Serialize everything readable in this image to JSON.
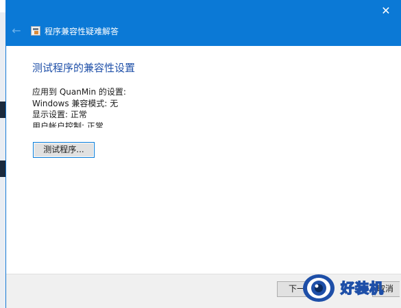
{
  "window": {
    "title": "程序兼容性疑难解答",
    "close_glyph": "✕",
    "back_glyph": "←"
  },
  "main": {
    "heading": "测试程序的兼容性设置",
    "settings": [
      "应用到  QuanMin 的设置:",
      "Windows 兼容模式: 无",
      "显示设置:  正常",
      "用户帐户控制:  正常"
    ],
    "test_button_label": "测试程序..."
  },
  "footer": {
    "next_label": "下一步",
    "cancel_label": "取消"
  },
  "watermark": {
    "text": "好装机"
  },
  "colors": {
    "titlebar": "#0b79d6",
    "heading": "#1e4fa8",
    "footer": "#f0f0f0"
  }
}
